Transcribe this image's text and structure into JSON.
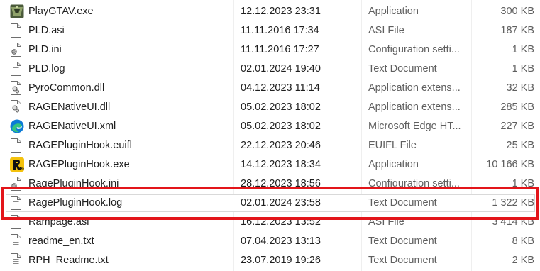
{
  "files": [
    {
      "name": "PlayGTAV.exe",
      "date": "12.12.2023 23:31",
      "type": "Application",
      "size": "300 KB",
      "icon": "gtav-exe-icon"
    },
    {
      "name": "PLD.asi",
      "date": "11.11.2016 17:34",
      "type": "ASI File",
      "size": "187 KB",
      "icon": "blank-file-icon"
    },
    {
      "name": "PLD.ini",
      "date": "11.11.2016 17:27",
      "type": "Configuration setti...",
      "size": "1 KB",
      "icon": "settings-file-icon"
    },
    {
      "name": "PLD.log",
      "date": "02.01.2024 19:40",
      "type": "Text Document",
      "size": "1 KB",
      "icon": "text-file-icon"
    },
    {
      "name": "PyroCommon.dll",
      "date": "04.12.2023 11:14",
      "type": "Application extens...",
      "size": "32 KB",
      "icon": "dll-file-icon"
    },
    {
      "name": "RAGENativeUI.dll",
      "date": "05.02.2023 18:02",
      "type": "Application extens...",
      "size": "285 KB",
      "icon": "dll-file-icon"
    },
    {
      "name": "RAGENativeUI.xml",
      "date": "05.02.2023 18:02",
      "type": "Microsoft Edge HT...",
      "size": "227 KB",
      "icon": "edge-icon"
    },
    {
      "name": "RAGEPluginHook.euifl",
      "date": "22.12.2023 20:46",
      "type": "EUIFL File",
      "size": "25 KB",
      "icon": "blank-file-icon"
    },
    {
      "name": "RAGEPluginHook.exe",
      "date": "14.12.2023 18:34",
      "type": "Application",
      "size": "10 166 KB",
      "icon": "rage-exe-icon"
    },
    {
      "name": "RagePluginHook.ini",
      "date": "28.12.2023 18:56",
      "type": "Configuration setti...",
      "size": "1 KB",
      "icon": "settings-file-icon"
    },
    {
      "name": "RagePluginHook.log",
      "date": "02.01.2024 23:58",
      "type": "Text Document",
      "size": "1 322 KB",
      "icon": "text-file-icon",
      "highlighted": true
    },
    {
      "name": "Rampage.asi",
      "date": "16.12.2023 13:52",
      "type": "ASI File",
      "size": "3 414 KB",
      "icon": "blank-file-icon"
    },
    {
      "name": "readme_en.txt",
      "date": "07.04.2023 13:13",
      "type": "Text Document",
      "size": "8 KB",
      "icon": "text-file-icon"
    },
    {
      "name": "RPH_Readme.txt",
      "date": "23.07.2019 19:26",
      "type": "Text Document",
      "size": "2 KB",
      "icon": "text-file-icon"
    }
  ],
  "colors": {
    "highlight_frame": "#e3151a",
    "secondary_text": "#5f5f5f",
    "edge_blue": "#0c7bd6",
    "edge_green": "#33c481",
    "rage_yellow": "#f4c20d"
  }
}
